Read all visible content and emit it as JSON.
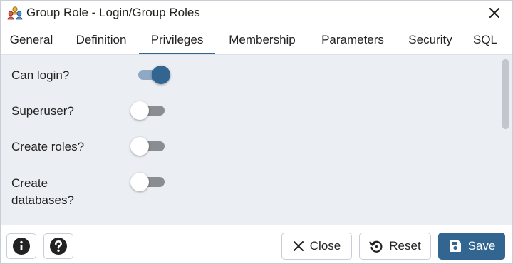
{
  "window": {
    "title": "Group Role - Login/Group Roles",
    "icon": "group-role-icon"
  },
  "tabs": [
    {
      "label": "General",
      "active": false
    },
    {
      "label": "Definition",
      "active": false
    },
    {
      "label": "Privileges",
      "active": true
    },
    {
      "label": "Membership",
      "active": false
    },
    {
      "label": "Parameters",
      "active": false
    },
    {
      "label": "Security",
      "active": false
    },
    {
      "label": "SQL",
      "active": false
    }
  ],
  "privileges": [
    {
      "label": "Can login?",
      "on": true
    },
    {
      "label": "Superuser?",
      "on": false
    },
    {
      "label": "Create roles?",
      "on": false
    },
    {
      "label_line1": "Create",
      "label_line2": "databases?",
      "on": false
    }
  ],
  "footer": {
    "info_icon": "info-icon",
    "help_icon": "help-icon",
    "close_label": "Close",
    "reset_label": "Reset",
    "save_label": "Save"
  },
  "colors": {
    "accent": "#326690",
    "content_bg": "#ebeef3",
    "toggle_off_track": "#8a8d91",
    "toggle_on_track": "#8fa8c3"
  }
}
